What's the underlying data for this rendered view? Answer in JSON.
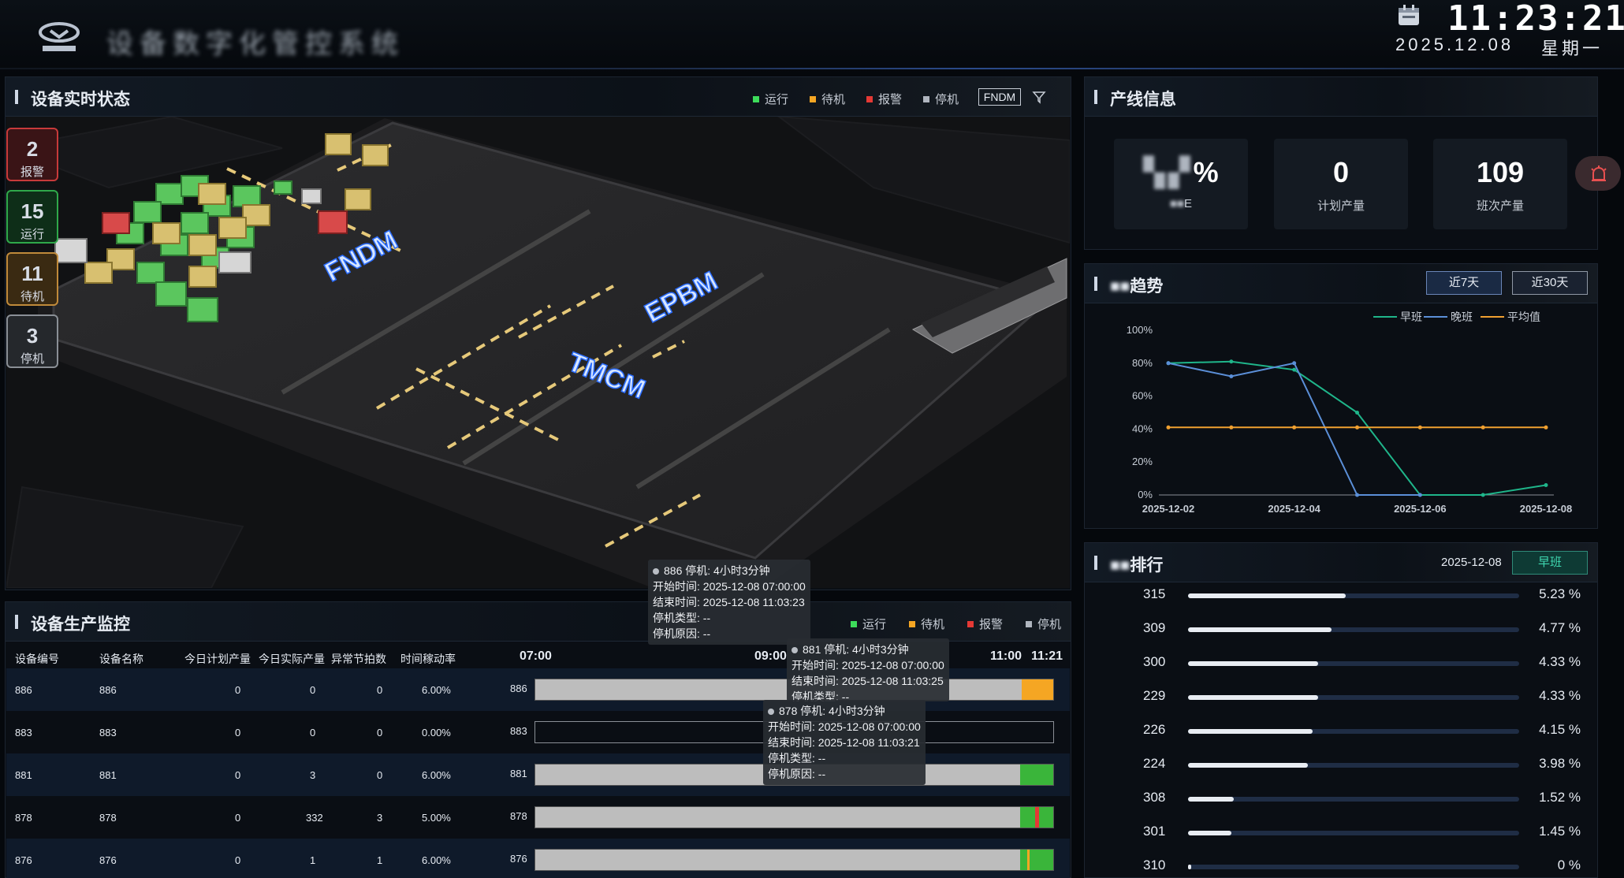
{
  "header": {
    "title": "设备数字化管控系统",
    "time": "11:23:21",
    "date": "2025.12.08",
    "weekday": "星期一"
  },
  "status_panel": {
    "title": "设备实时状态",
    "legend": [
      {
        "label": "运行",
        "color": "#3ddc5a"
      },
      {
        "label": "待机",
        "color": "#f5a623"
      },
      {
        "label": "报警",
        "color": "#e53935"
      },
      {
        "label": "停机",
        "color": "#b0b6bf"
      }
    ],
    "area_button": "FNDM",
    "counters": [
      {
        "value": "2",
        "label": "报警"
      },
      {
        "value": "15",
        "label": "运行"
      },
      {
        "value": "11",
        "label": "待机"
      },
      {
        "value": "3",
        "label": "停机"
      }
    ],
    "zones": [
      "FNDM",
      "EPBM",
      "TMCM"
    ]
  },
  "monitor_panel": {
    "title": "设备生产监控",
    "legend": [
      {
        "label": "运行",
        "color": "#3ddc5a"
      },
      {
        "label": "待机",
        "color": "#f5a623"
      },
      {
        "label": "报警",
        "color": "#e53935"
      },
      {
        "label": "停机",
        "color": "#b0b6bf"
      }
    ],
    "columns": [
      "设备编号",
      "设备名称",
      "今日计划产量",
      "今日实际产量",
      "异常节拍数",
      "时间稼动率"
    ],
    "time_ticks": [
      "07:00",
      "09:00",
      "11:00",
      "11:21"
    ],
    "rows": [
      {
        "code": "886",
        "name": "886",
        "plan": "0",
        "actual": "0",
        "abnormal": "0",
        "rate": "6.00%",
        "label": "886"
      },
      {
        "code": "883",
        "name": "883",
        "plan": "0",
        "actual": "0",
        "abnormal": "0",
        "rate": "0.00%",
        "label": "883"
      },
      {
        "code": "881",
        "name": "881",
        "plan": "0",
        "actual": "3",
        "abnormal": "0",
        "rate": "6.00%",
        "label": "881"
      },
      {
        "code": "878",
        "name": "878",
        "plan": "0",
        "actual": "332",
        "abnormal": "3",
        "rate": "5.00%",
        "label": "878"
      },
      {
        "code": "876",
        "name": "876",
        "plan": "0",
        "actual": "1",
        "abnormal": "1",
        "rate": "6.00%",
        "label": "876"
      }
    ],
    "tooltips": [
      {
        "head": "886 停机: 4小时3分钟",
        "start": "开始时间: 2025-12-08 07:00:00",
        "end": "结束时间: 2025-12-08 11:03:23",
        "type": "停机类型: --",
        "reason": "停机原因: --"
      },
      {
        "head": "881 停机: 4小时3分钟",
        "start": "开始时间: 2025-12-08 07:00:00",
        "end": "结束时间: 2025-12-08 11:03:25",
        "type": "停机类型: --"
      },
      {
        "head": "878 停机: 4小时3分钟",
        "start": "开始时间: 2025-12-08 07:00:00",
        "end": "结束时间: 2025-12-08 11:03:21",
        "type": "停机类型: --",
        "reason": "停机原因: --"
      }
    ]
  },
  "line_info": {
    "title": "产线信息",
    "stats": [
      {
        "value": "%",
        "label": "E"
      },
      {
        "value": "0",
        "label": "计划产量"
      },
      {
        "value": "109",
        "label": "班次产量"
      }
    ]
  },
  "trend": {
    "title": "趋势",
    "buttons": [
      "近7天",
      "近30天"
    ],
    "legend": [
      "早班",
      "晚班",
      "平均值"
    ]
  },
  "chart_data": {
    "type": "line",
    "x": [
      "2025-12-02",
      "2025-12-03",
      "2025-12-04",
      "2025-12-05",
      "2025-12-06",
      "2025-12-07",
      "2025-12-08"
    ],
    "xticks": [
      "2025-12-02",
      "2025-12-04",
      "2025-12-06",
      "2025-12-08"
    ],
    "yticks": [
      "100%",
      "80%",
      "60%",
      "40%",
      "20%",
      "0%"
    ],
    "ylim": [
      0,
      100
    ],
    "series": [
      {
        "name": "早班",
        "color": "#1fb58a",
        "values": [
          80,
          81,
          76,
          50,
          0,
          0,
          6
        ]
      },
      {
        "name": "晚班",
        "color": "#5b8fd8",
        "values": [
          80,
          72,
          80,
          0,
          0,
          null,
          null
        ]
      },
      {
        "name": "平均值",
        "color": "#f0a030",
        "values": [
          41,
          41,
          41,
          41,
          41,
          41,
          41
        ]
      }
    ]
  },
  "ranking": {
    "title": "排行",
    "date": "2025-12-08",
    "shift_button": "早班",
    "items": [
      {
        "id": "315",
        "pct": "5.23 %",
        "value": 5.23
      },
      {
        "id": "309",
        "pct": "4.77 %",
        "value": 4.77
      },
      {
        "id": "300",
        "pct": "4.33 %",
        "value": 4.33
      },
      {
        "id": "229",
        "pct": "4.33 %",
        "value": 4.33
      },
      {
        "id": "226",
        "pct": "4.15 %",
        "value": 4.15
      },
      {
        "id": "224",
        "pct": "3.98 %",
        "value": 3.98
      },
      {
        "id": "308",
        "pct": "1.52 %",
        "value": 1.52
      },
      {
        "id": "301",
        "pct": "1.45 %",
        "value": 1.45
      },
      {
        "id": "310",
        "pct": "0 %",
        "value": 0
      }
    ]
  }
}
